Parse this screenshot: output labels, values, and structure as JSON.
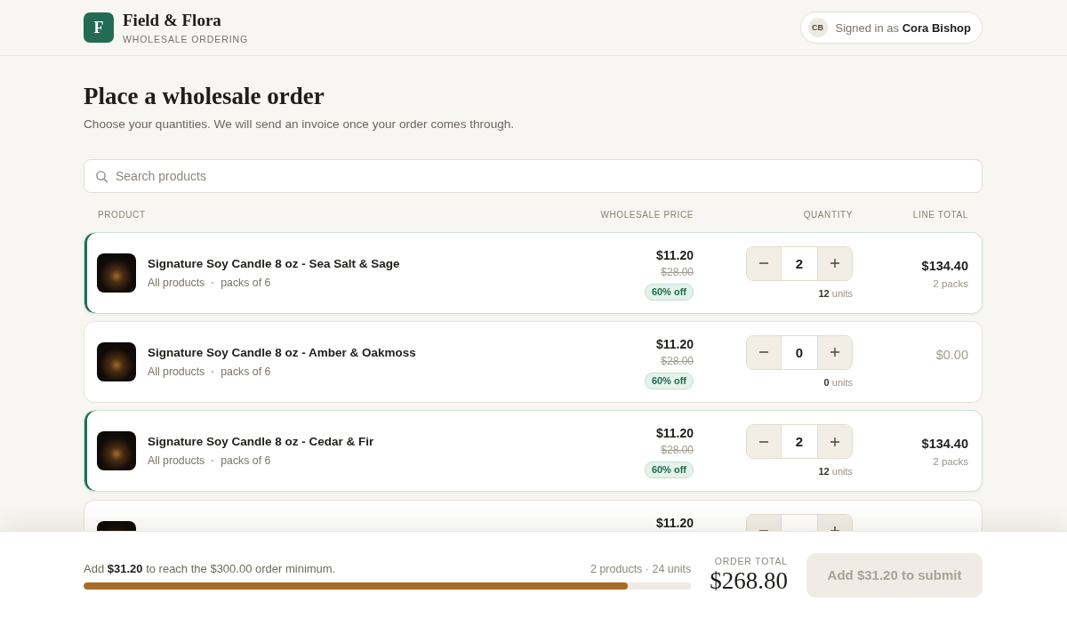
{
  "header": {
    "logo_letter": "F",
    "brand": "Field & Flora",
    "tagline": "WHOLESALE ORDERING",
    "user": {
      "initials": "CB",
      "signed_in": "Signed in as **Cora Bishop**"
    }
  },
  "page": {
    "title": "Place a wholesale order",
    "subtitle": "Choose your quantities. We will send an invoice once your order comes through."
  },
  "search": {
    "placeholder": "Search products"
  },
  "table": {
    "columns": [
      "PRODUCT",
      "WHOLESALE PRICE",
      "QUANTITY",
      "LINE TOTAL"
    ],
    "rows": [
      {
        "name": "Signature Soy Candle 8 oz - Sea Salt & Sage",
        "collection": "All products",
        "pack": "packs of 6",
        "price": "$11.20",
        "list_price": "$28.00",
        "discount": "60% off",
        "quantity": "2",
        "units": "**12** units",
        "line_total": "$134.40",
        "packs": "2 packs",
        "in_order": true
      },
      {
        "name": "Signature Soy Candle 8 oz - Amber & Oakmoss",
        "collection": "All products",
        "pack": "packs of 6",
        "price": "$11.20",
        "list_price": "$28.00",
        "discount": "60% off",
        "quantity": "0",
        "units": "**0** units",
        "line_total": "$0.00",
        "in_order": false
      },
      {
        "name": "Signature Soy Candle 8 oz - Cedar & Fir",
        "collection": "All products",
        "pack": "packs of 6",
        "price": "$11.20",
        "list_price": "$28.00",
        "discount": "60% off",
        "quantity": "2",
        "units": "**12** units",
        "line_total": "$134.40",
        "packs": "2 packs",
        "in_order": true
      },
      {
        "price": "$11.20",
        "in_order": false
      }
    ]
  },
  "footer": {
    "minimum_note": "Add **$31.20** to reach the $300.00 order minimum.",
    "summary": "2 products · 24 units",
    "progress": {
      "level": 0.896
    },
    "total_label": "ORDER TOTAL",
    "total": "$268.80",
    "submit": {
      "label": "Add $31.20 to submit",
      "disabled": true
    }
  }
}
